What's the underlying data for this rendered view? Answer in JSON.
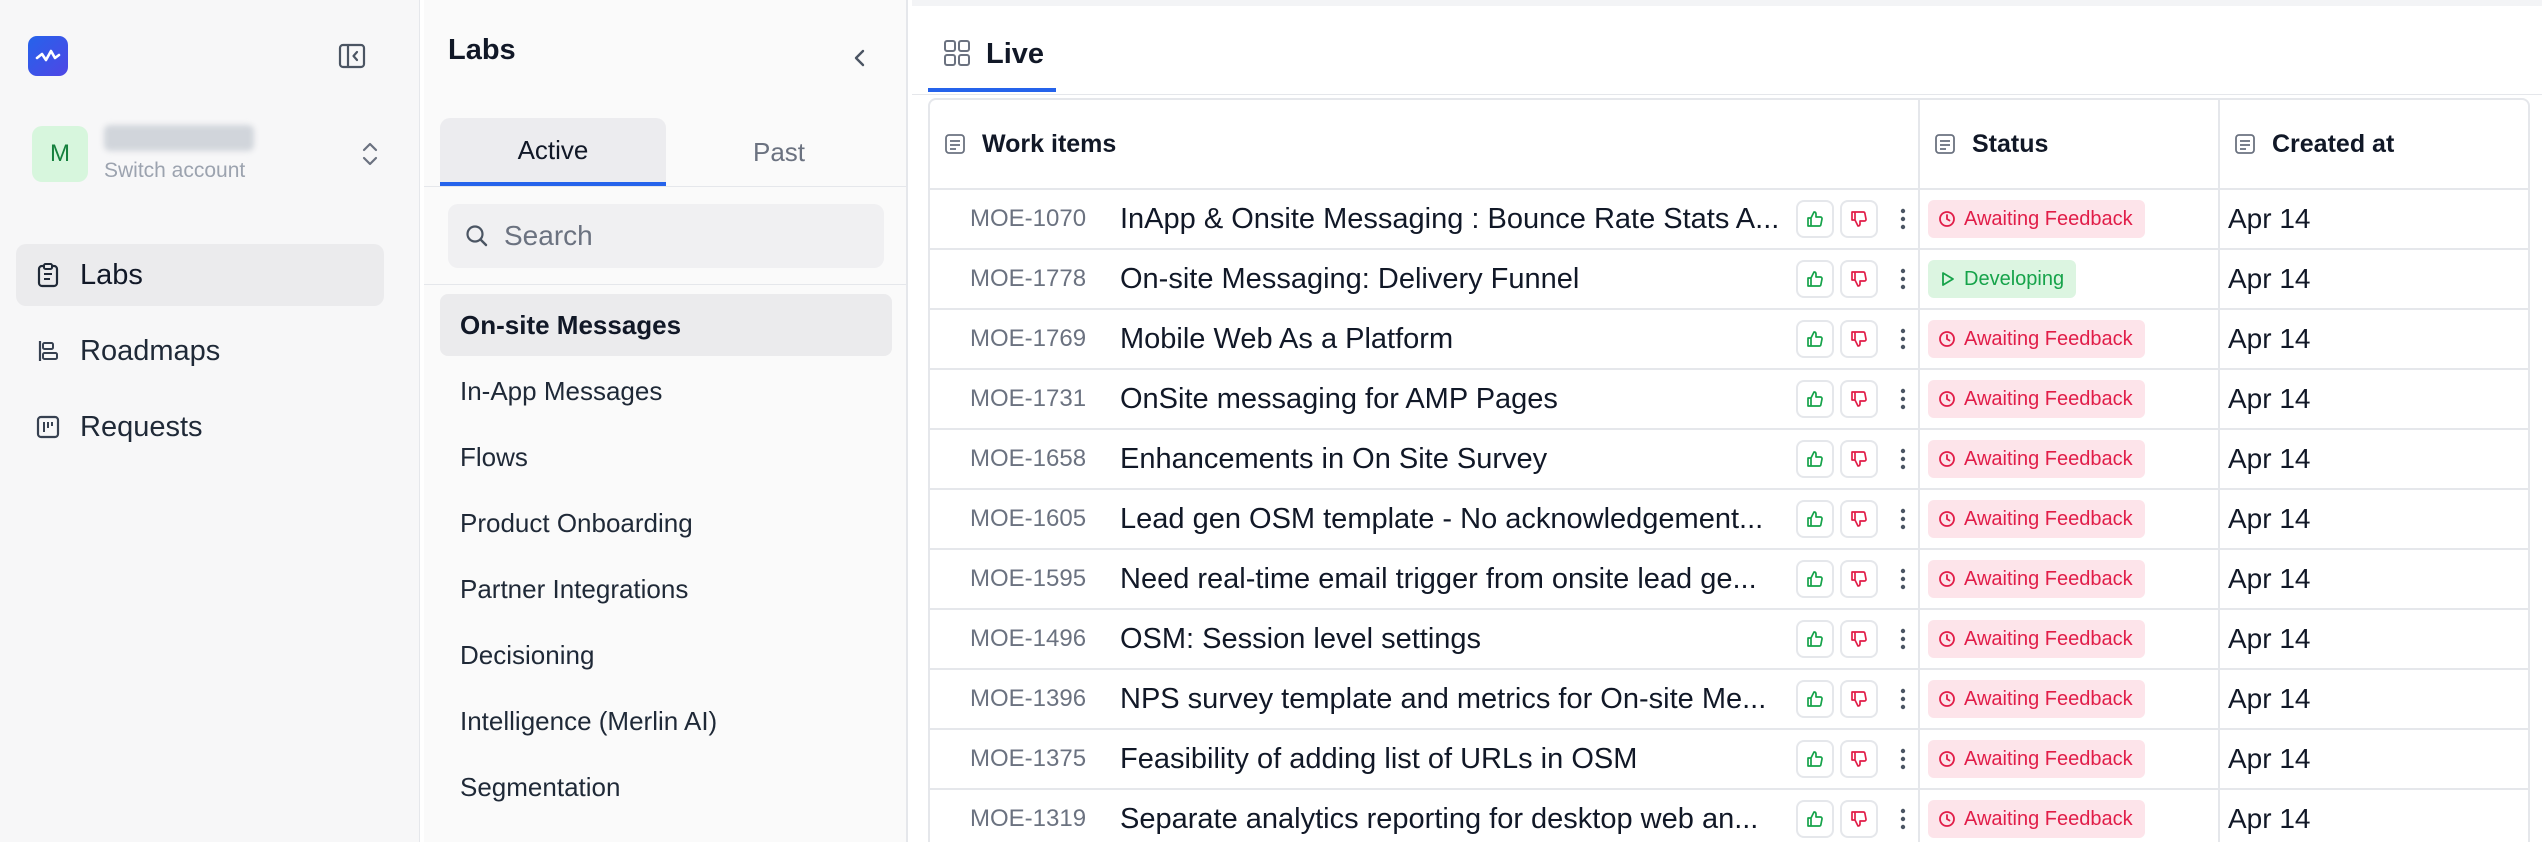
{
  "nav": {
    "account": {
      "initial": "M",
      "subtitle": "Switch account"
    },
    "items": [
      {
        "label": "Labs",
        "icon": "clipboard-icon",
        "active": true
      },
      {
        "label": "Roadmaps",
        "icon": "roadmap-icon",
        "active": false
      },
      {
        "label": "Requests",
        "icon": "requests-icon",
        "active": false
      }
    ]
  },
  "labs": {
    "title": "Labs",
    "tabs": [
      {
        "label": "Active",
        "active": true
      },
      {
        "label": "Past",
        "active": false
      }
    ],
    "search_placeholder": "Search",
    "items": [
      "On-site Messages",
      "In-App Messages",
      "Flows",
      "Product Onboarding",
      "Partner Integrations",
      "Decisioning",
      "Intelligence (Merlin AI)",
      "Segmentation"
    ],
    "active_item": "On-site Messages"
  },
  "main": {
    "view_tab": "Live",
    "columns": {
      "work": "Work items",
      "status": "Status",
      "created": "Created at"
    },
    "rows": [
      {
        "id": "MOE-1070",
        "title": "InApp & Onsite Messaging : Bounce Rate Stats A...",
        "status": "Awaiting Feedback",
        "status_kind": "awaiting",
        "created": "Apr 14"
      },
      {
        "id": "MOE-1778",
        "title": "On-site Messaging: Delivery Funnel",
        "status": "Developing",
        "status_kind": "developing",
        "created": "Apr 14"
      },
      {
        "id": "MOE-1769",
        "title": "Mobile Web As a Platform",
        "status": "Awaiting Feedback",
        "status_kind": "awaiting",
        "created": "Apr 14"
      },
      {
        "id": "MOE-1731",
        "title": "OnSite messaging for AMP Pages",
        "status": "Awaiting Feedback",
        "status_kind": "awaiting",
        "created": "Apr 14"
      },
      {
        "id": "MOE-1658",
        "title": "Enhancements in On Site Survey",
        "status": "Awaiting Feedback",
        "status_kind": "awaiting",
        "created": "Apr 14"
      },
      {
        "id": "MOE-1605",
        "title": "Lead gen OSM template - No acknowledgement...",
        "status": "Awaiting Feedback",
        "status_kind": "awaiting",
        "created": "Apr 14"
      },
      {
        "id": "MOE-1595",
        "title": "Need real-time email trigger from onsite lead ge...",
        "status": "Awaiting Feedback",
        "status_kind": "awaiting",
        "created": "Apr 14"
      },
      {
        "id": "MOE-1496",
        "title": "OSM: Session level settings",
        "status": "Awaiting Feedback",
        "status_kind": "awaiting",
        "created": "Apr 14"
      },
      {
        "id": "MOE-1396",
        "title": "NPS survey template and metrics for On-site Me...",
        "status": "Awaiting Feedback",
        "status_kind": "awaiting",
        "created": "Apr 14"
      },
      {
        "id": "MOE-1375",
        "title": "Feasibility of adding list of URLs in OSM",
        "status": "Awaiting Feedback",
        "status_kind": "awaiting",
        "created": "Apr 14"
      },
      {
        "id": "MOE-1319",
        "title": "Separate analytics reporting for desktop web an...",
        "status": "Awaiting Feedback",
        "status_kind": "awaiting",
        "created": "Apr 14"
      }
    ]
  },
  "colors": {
    "accent": "#2563eb",
    "awaiting_bg": "#fde4ea",
    "awaiting_fg": "#e11d48",
    "developing_bg": "#dcf5e1",
    "developing_fg": "#16a34a",
    "upvote": "#16a34a",
    "downvote": "#e11d48"
  }
}
